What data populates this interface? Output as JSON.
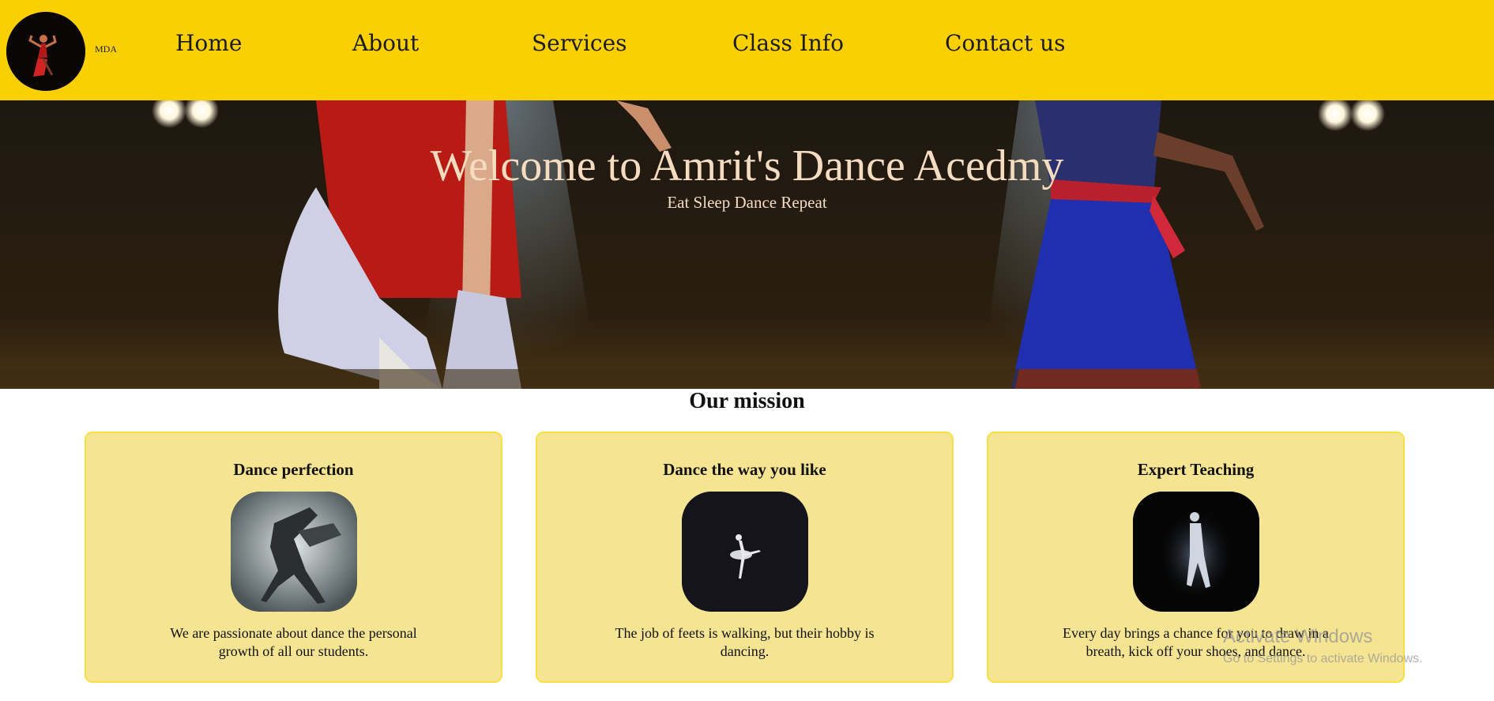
{
  "header": {
    "logo_text": "MDA",
    "nav": [
      {
        "label": "Home"
      },
      {
        "label": "About"
      },
      {
        "label": "Services"
      },
      {
        "label": "Class Info"
      },
      {
        "label": "Contact us"
      }
    ]
  },
  "hero": {
    "title": "Welcome to Amrit's Dance Acedmy",
    "subtitle": "Eat Sleep Dance Repeat"
  },
  "mission": {
    "title": "Our mission",
    "cards": [
      {
        "title": "Dance perfection",
        "text": "We are passionate about dance the personal growth of all our students."
      },
      {
        "title": "Dance the way you like",
        "text": "The job of feets is walking, but their hobby is dancing."
      },
      {
        "title": "Expert Teaching",
        "text": "Every day brings a chance for you to draw in a breath, kick off your shoes, and dance."
      }
    ]
  },
  "watermark": {
    "line1": "Activate Windows",
    "line2": "Go to Settings to activate Windows."
  },
  "colors": {
    "header_bg": "#fad000",
    "card_bg": "#f5e492",
    "hero_text": "#f5dcc0"
  }
}
